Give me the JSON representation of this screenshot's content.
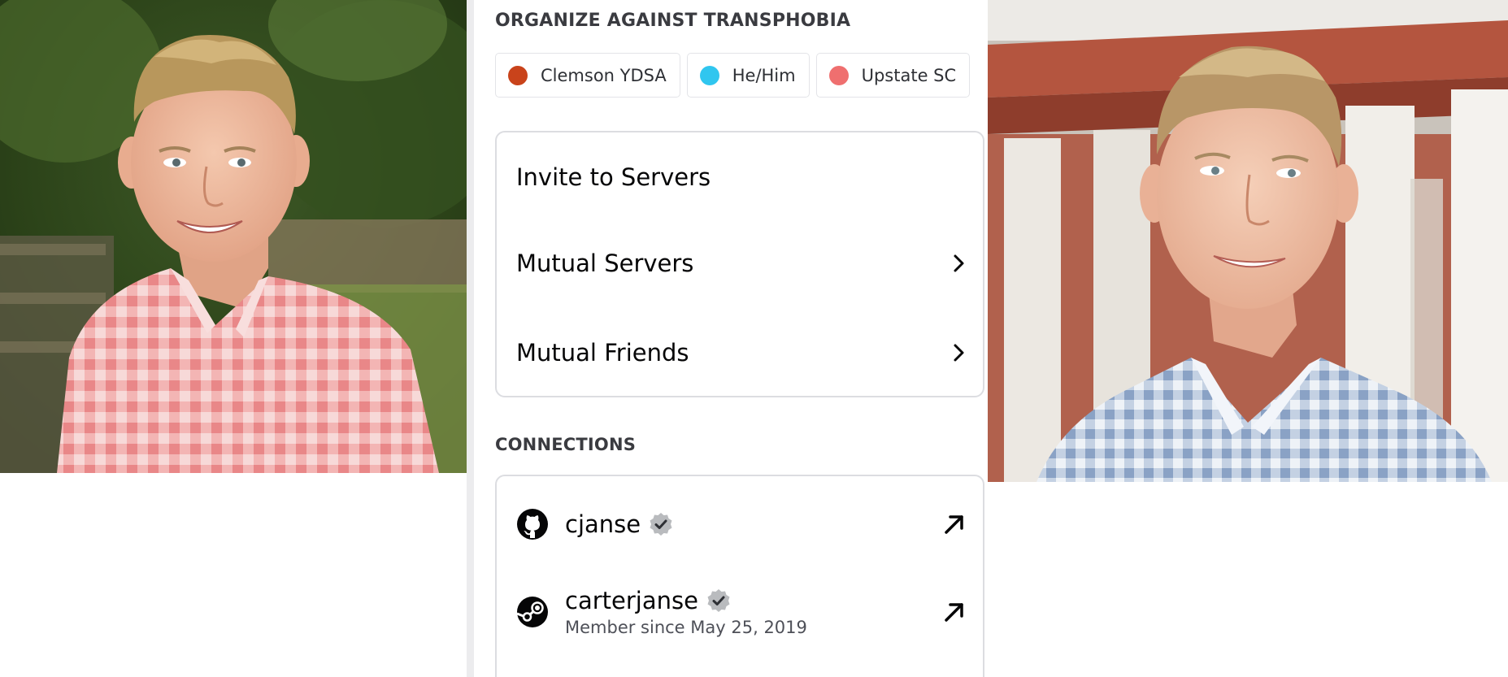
{
  "profile": {
    "roles_heading": "ORGANIZE AGAINST TRANSPHOBIA",
    "roles": [
      {
        "label": "Clemson YDSA",
        "color": "#c9431b"
      },
      {
        "label": "He/Him",
        "color": "#30c6ef"
      },
      {
        "label": "Upstate SC",
        "color": "#ef6f6f"
      }
    ],
    "actions": {
      "invite": "Invite to Servers",
      "mutual_servers": "Mutual Servers",
      "mutual_friends": "Mutual Friends"
    },
    "connections_heading": "CONNECTIONS",
    "connections": [
      {
        "service_icon": "github-icon",
        "name": "cjanse",
        "verified": true
      },
      {
        "service_icon": "steam-icon",
        "name": "carterjanse",
        "verified": true,
        "subtitle": "Member since May 25, 2019"
      }
    ]
  },
  "photos": {
    "left": {
      "description_icon": "portrait-photo",
      "shirt": "pink gingham",
      "background": "green foliage"
    },
    "right": {
      "description_icon": "portrait-photo",
      "shirt": "blue gingham",
      "background": "red brick building with white columns"
    }
  }
}
